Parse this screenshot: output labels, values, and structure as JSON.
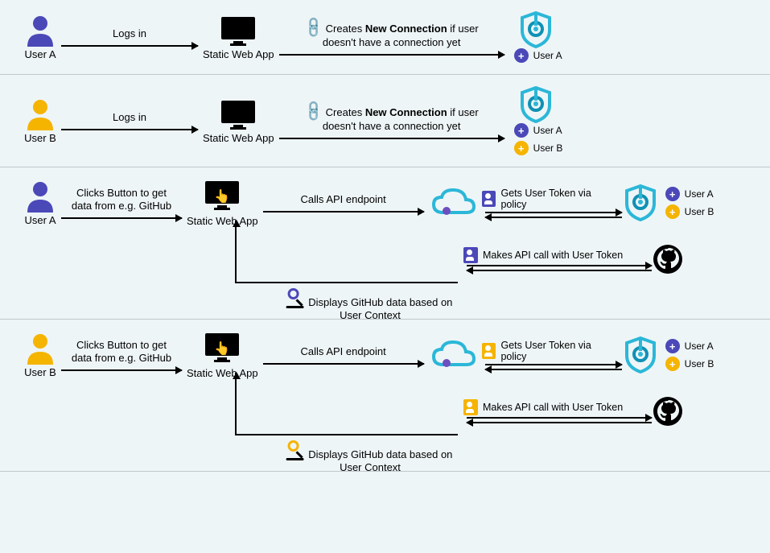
{
  "colors": {
    "purple": "#4b48b8",
    "orange": "#f5b400",
    "cyan": "#2bb7d8",
    "cyanD": "#0f91b5"
  },
  "users": {
    "a": "User A",
    "b": "User B"
  },
  "nodes": {
    "swa": "Static Web App"
  },
  "actions": {
    "login": "Logs in",
    "newconn_pre": "Creates ",
    "newconn_bold": "New Connection",
    "newconn_post": " if user\ndoesn't have a connection yet",
    "click": "Clicks Button to get\ndata from e.g. GitHub",
    "callapi": "Calls API endpoint",
    "gettoken": "Gets User Token via policy",
    "makecall": "Makes API call with User Token",
    "display": "Displays GitHub data based on\nUser Context"
  }
}
